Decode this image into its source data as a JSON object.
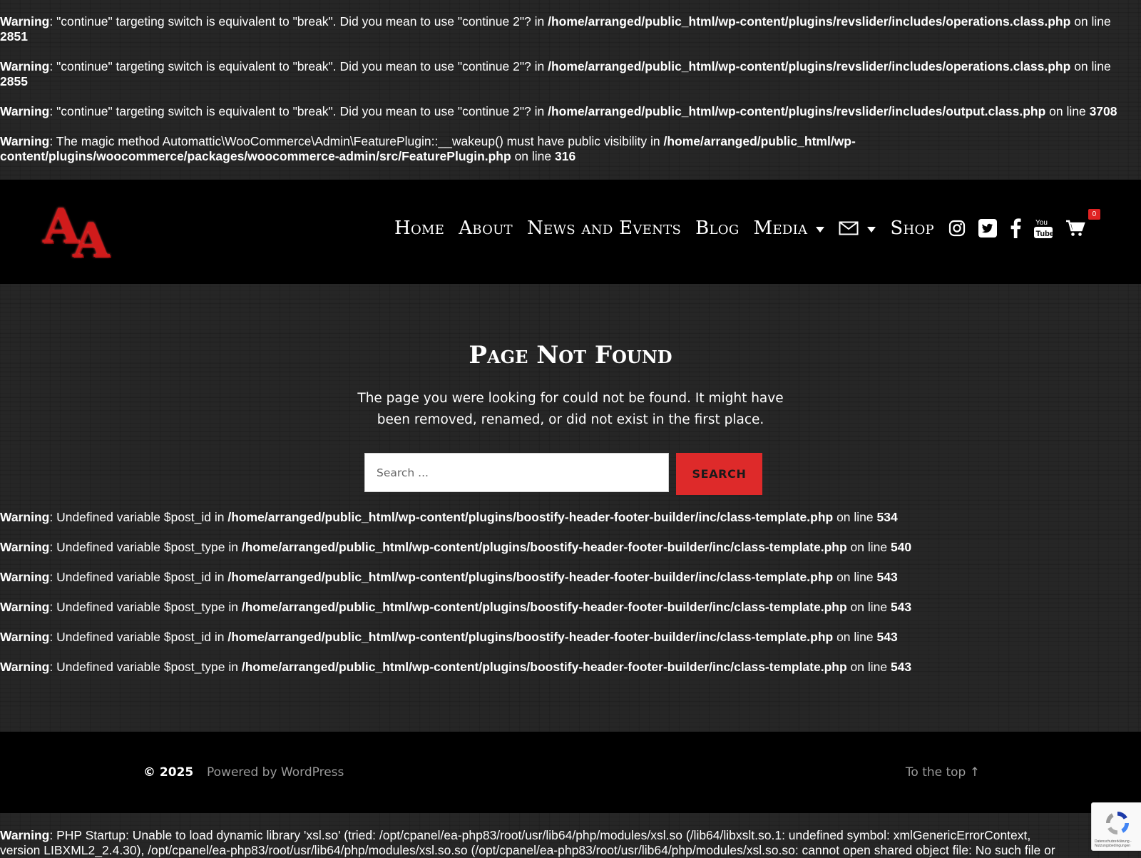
{
  "warnings_top": [
    {
      "label": "Warning",
      "msg": ": \"continue\" targeting switch is equivalent to \"break\". Did you mean to use \"continue 2\"? in ",
      "file": "/home/arranged/public_html/wp-content/plugins/revslider/includes/operations.class.php",
      "mid": " on line ",
      "line": "2851"
    },
    {
      "label": "Warning",
      "msg": ": \"continue\" targeting switch is equivalent to \"break\". Did you mean to use \"continue 2\"? in ",
      "file": "/home/arranged/public_html/wp-content/plugins/revslider/includes/operations.class.php",
      "mid": " on line ",
      "line": "2855"
    },
    {
      "label": "Warning",
      "msg": ": \"continue\" targeting switch is equivalent to \"break\". Did you mean to use \"continue 2\"? in ",
      "file": "/home/arranged/public_html/wp-content/plugins/revslider/includes/output.class.php",
      "mid": " on line ",
      "line": "3708"
    },
    {
      "label": "Warning",
      "msg": ": The magic method Automattic\\WooCommerce\\Admin\\FeaturePlugin::__wakeup() must have public visibility in ",
      "file": "/home/arranged/public_html/wp-content/plugins/woocommerce/packages/woocommerce-admin/src/FeaturePlugin.php",
      "mid": " on line ",
      "line": "316"
    }
  ],
  "logo_letters": "AA",
  "nav": {
    "home": "Home",
    "about": "About",
    "news": "News and Events",
    "blog": "Blog",
    "media": "Media",
    "shop": "Shop",
    "cart_count": "0"
  },
  "icons": {
    "mail": "mail-icon",
    "instagram": "instagram-icon",
    "twitter": "twitter-icon",
    "facebook": "facebook-icon",
    "youtube": "youtube-icon",
    "cart": "cart-icon"
  },
  "main": {
    "title": "Page Not Found",
    "text": "The page you were looking for could not be found. It might have been removed, renamed, or did not exist in the first place.",
    "search_placeholder": "Search ...",
    "search_button": "SEARCH"
  },
  "warnings_mid": [
    {
      "label": "Warning",
      "msg": ": Undefined variable $post_id in ",
      "file": "/home/arranged/public_html/wp-content/plugins/boostify-header-footer-builder/inc/class-template.php",
      "mid": " on line ",
      "line": "534"
    },
    {
      "label": "Warning",
      "msg": ": Undefined variable $post_type in ",
      "file": "/home/arranged/public_html/wp-content/plugins/boostify-header-footer-builder/inc/class-template.php",
      "mid": " on line ",
      "line": "540"
    },
    {
      "label": "Warning",
      "msg": ": Undefined variable $post_id in ",
      "file": "/home/arranged/public_html/wp-content/plugins/boostify-header-footer-builder/inc/class-template.php",
      "mid": " on line ",
      "line": "543"
    },
    {
      "label": "Warning",
      "msg": ": Undefined variable $post_type in ",
      "file": "/home/arranged/public_html/wp-content/plugins/boostify-header-footer-builder/inc/class-template.php",
      "mid": " on line ",
      "line": "543"
    },
    {
      "label": "Warning",
      "msg": ": Undefined variable $post_id in ",
      "file": "/home/arranged/public_html/wp-content/plugins/boostify-header-footer-builder/inc/class-template.php",
      "mid": " on line ",
      "line": "543"
    },
    {
      "label": "Warning",
      "msg": ": Undefined variable $post_type in ",
      "file": "/home/arranged/public_html/wp-content/plugins/boostify-header-footer-builder/inc/class-template.php",
      "mid": " on line ",
      "line": "543"
    }
  ],
  "footer": {
    "copyright": "© 2025",
    "powered": "Powered by WordPress",
    "to_top": "To the top ↑"
  },
  "warning_bottom": {
    "label": "Warning",
    "line1": ": PHP Startup: Unable to load dynamic library 'xsl.so' (tried: /opt/cpanel/ea-php83/root/usr/lib64/php/modules/xsl.so (/lib64/libxslt.so.1: undefined symbol: xmlGenericErrorContext,",
    "line2": "version LIBXML2_2.4.30), /opt/cpanel/ea-php83/root/usr/lib64/php/modules/xsl.so.so (/opt/cpanel/ea-php83/root/usr/lib64/php/modules/xsl.so.so: cannot open shared object file: No such file or"
  },
  "recaptcha_text": "Datenschutzerklärung - Nutzungsbedingungen",
  "colors": {
    "accent": "#de2a2a",
    "header_bg": "#000000",
    "page_bg": "#262626"
  }
}
